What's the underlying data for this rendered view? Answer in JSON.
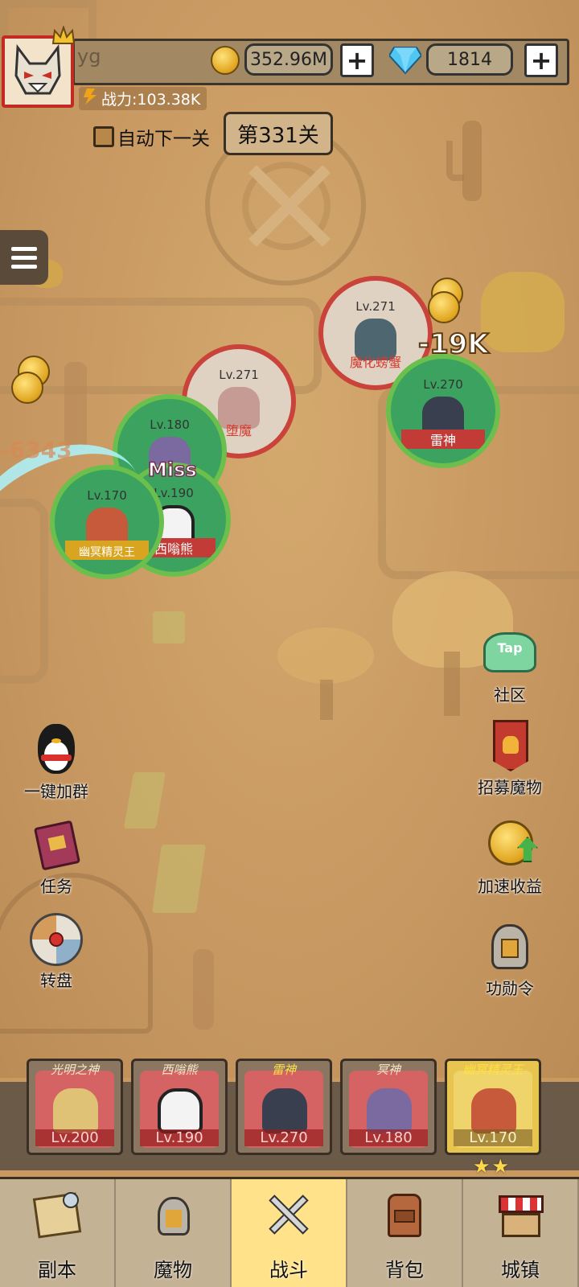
{
  "player": {
    "name": "yg",
    "power_label": "战力:103.38K",
    "gold": "352.96M",
    "gems": "1814",
    "add_symbol": "+"
  },
  "stage": {
    "auto_next_label": "自动下一关",
    "stage_label": "第331关"
  },
  "battle": {
    "units": [
      {
        "lv": "Lv.271",
        "name": "魔化螃蟹",
        "side": "enemy"
      },
      {
        "lv": "Lv.271",
        "name": "堕魔",
        "side": "enemy"
      },
      {
        "lv": "Lv.270",
        "name": "雷神",
        "side": "ally"
      },
      {
        "lv": "Lv.180",
        "name": "冥神",
        "side": "ally"
      },
      {
        "lv": "Lv.190",
        "name": "西嗡熊",
        "side": "ally"
      },
      {
        "lv": "Lv.170",
        "name": "幽冥精灵王",
        "side": "ally"
      }
    ],
    "damage_popup": "-19K",
    "damage_popup_faded": "-6343",
    "miss_text": "Miss"
  },
  "side_buttons": {
    "community": {
      "label": "社区",
      "badge": "Tap"
    },
    "join_group": {
      "label": "一键加群"
    },
    "recruit": {
      "label": "招募魔物"
    },
    "tasks": {
      "label": "任务"
    },
    "speed_income": {
      "label": "加速收益"
    },
    "wheel": {
      "label": "转盘"
    },
    "merit": {
      "label": "功勋令"
    }
  },
  "heroes": [
    {
      "name": "光明之神",
      "lv": "Lv.200"
    },
    {
      "name": "西嗡熊",
      "lv": "Lv.190"
    },
    {
      "name": "雷神",
      "lv": "Lv.270"
    },
    {
      "name": "冥神",
      "lv": "Lv.180"
    },
    {
      "name": "幽冥精灵王",
      "lv": "Lv.170",
      "stars": "★★"
    }
  ],
  "nav": {
    "dungeon": "副本",
    "monsters": "魔物",
    "battle": "战斗",
    "bag": "背包",
    "town": "城镇",
    "active": "battle"
  },
  "colors": {
    "ally_ring": "#6bbf4c",
    "enemy_ring": "#c9433a",
    "active_tab": "#ffe289"
  }
}
